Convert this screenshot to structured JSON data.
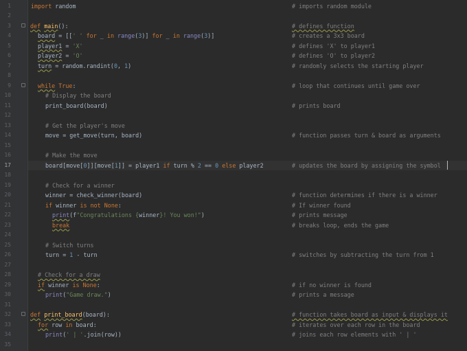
{
  "editor": {
    "active_line": 17,
    "line_numbers": [
      "1",
      "2",
      "3",
      "4",
      "5",
      "6",
      "7",
      "8",
      "9",
      "10",
      "11",
      "12",
      "13",
      "14",
      "15",
      "16",
      "17",
      "18",
      "19",
      "20",
      "21",
      "22",
      "23",
      "24",
      "25",
      "26",
      "27",
      "28",
      "29",
      "30",
      "31",
      "32",
      "33",
      "34",
      "35"
    ],
    "comments": {
      "c1": "# imports random module",
      "c3": "# defines function",
      "c4": "# creates a 3x3 board",
      "c5": "# defines 'X' to player1",
      "c6": "# defines 'O' to player2",
      "c7": "# randomly selects the starting player",
      "c9": "# loop that continues until game over",
      "c11": "# prints board",
      "c14": "# function passes turn & board as arguments",
      "c17": "# updates the board by assigning the symbol",
      "c20": "# function determines if there is a winner",
      "c21": "# If winner found",
      "c22": "# prints message",
      "c23": "# breaks loop, ends the game",
      "c26": "# switches by subtracting the turn from 1",
      "c29": "# if no winner is found",
      "c30": "# prints a message",
      "c32": "# function takes board as input & displays it",
      "c33": "# iterates over each row in the board",
      "c34": "# joins each row elements with ' | '"
    },
    "tokens": {
      "l1_import": "import",
      "l1_rest": " random",
      "l3_def": "def",
      "l3_name": "main",
      "l3_rest": "():",
      "l4_var": "board",
      "l4_a": " = [[",
      "l4_s1": "' '",
      "l4_for1": "for",
      "l4_b": " _ ",
      "l4_in1": "in",
      "l4_range1": "range",
      "l4_c": "(",
      "l4_n1": "3",
      "l4_d": ")] ",
      "l4_for2": "for",
      "l4_in2": "in",
      "l4_range2": "range",
      "l4_n2": "3",
      "l4_e": ")]",
      "l5_var": "player1",
      "l5_eq": " = ",
      "l5_s": "'X'",
      "l6_var": "player2",
      "l6_eq": " = ",
      "l6_s": "'O'",
      "l7_var": "turn",
      "l7_a": " = random.randint(",
      "l7_n1": "0",
      "l7_b": ", ",
      "l7_n2": "1",
      "l7_c": ")",
      "l9_kw": "while",
      "l9_true": "True",
      "l9_colon": ":",
      "l10_c": "# Display the board",
      "l11": "print_board(board)",
      "l13_c": "# Get the player's move",
      "l14": "move = get_move(turn, board)",
      "l16_c": "# Make the move",
      "l17_a": "board[move[",
      "l17_n0": "0",
      "l17_b": "]][move[",
      "l17_n1": "1",
      "l17_c": "]] = player1 ",
      "l17_if": "if",
      "l17_d": " turn % ",
      "l17_n2": "2",
      "l17_e": " == ",
      "l17_n3": "0",
      "l17_else": "else",
      "l17_f": " player2",
      "l19_c": "# Check for a winner",
      "l20": "winner = check_winner(board)",
      "l21_if": "if",
      "l21_a": " winner ",
      "l21_is": "is not",
      "l21_none": "None",
      "l21_colon": ":",
      "l22_print": "print",
      "l22_f": "(f",
      "l22_s1": "\"Congratulations {",
      "l22_var": "winner",
      "l22_s2": "}! You won!\"",
      "l22_close": ")",
      "l23_break": "break",
      "l25_c": "# Switch turns",
      "l26_a": "turn = ",
      "l26_n": "1",
      "l26_b": " - turn",
      "l28_c": "# Check for a draw",
      "l29_if": "if",
      "l29_a": " winner ",
      "l29_is": "is",
      "l29_none": "None",
      "l29_colon": ":",
      "l30_print": "print",
      "l30_a": "(",
      "l30_s": "\"Game draw.\"",
      "l30_b": ")",
      "l32_def": "def",
      "l32_name": "print_board",
      "l32_rest": "(board):",
      "l33_for": "for",
      "l33_a": " row ",
      "l33_in": "in",
      "l33_b": " board:",
      "l34_print": "print",
      "l34_a": "(",
      "l34_s": "' | '",
      "l34_b": ".join(row))"
    },
    "colors": {
      "background": "#2b2b2b",
      "gutter": "#313335",
      "keyword": "#cc7832",
      "string": "#6a8759",
      "number": "#6897bb",
      "function": "#ffc66d",
      "comment": "#808080",
      "text": "#a9b7c6"
    }
  }
}
